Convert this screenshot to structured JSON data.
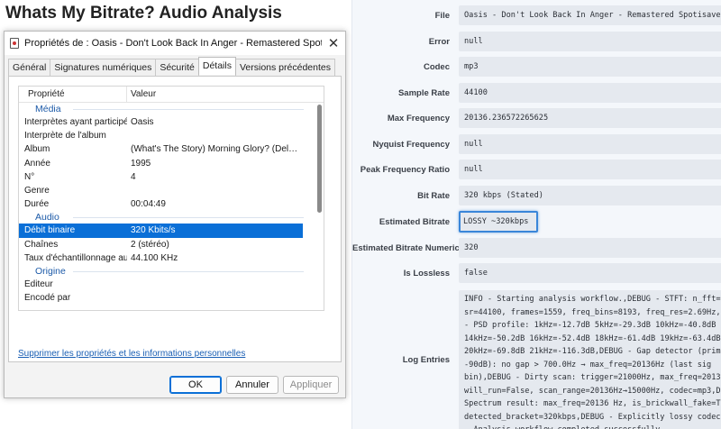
{
  "page_title": "Whats My Bitrate? Audio Analysis",
  "dialog": {
    "title": "Propriétés de : Oasis - Don't Look Back In Anger - Remastered Spotisaver.m...",
    "close_glyph": "✕",
    "tabs": [
      "Général",
      "Signatures numériques",
      "Sécurité",
      "Détails",
      "Versions précédentes"
    ],
    "active_tab": "Détails",
    "columns": {
      "property": "Propriété",
      "value": "Valeur"
    },
    "groups": [
      {
        "label": "Média",
        "rows": [
          {
            "prop": "Interprètes ayant participé",
            "val": "Oasis"
          },
          {
            "prop": "Interprète de l'album",
            "val": ""
          },
          {
            "prop": "Album",
            "val": "(What's The Story) Morning Glory? (Deluxe Re..."
          },
          {
            "prop": "Année",
            "val": "1995"
          },
          {
            "prop": "N°",
            "val": "4"
          },
          {
            "prop": "Genre",
            "val": ""
          },
          {
            "prop": "Durée",
            "val": "00:04:49"
          }
        ]
      },
      {
        "label": "Audio",
        "rows": [
          {
            "prop": "Débit binaire",
            "val": "320 Kbits/s",
            "selected": true
          },
          {
            "prop": "Chaînes",
            "val": "2 (stéréo)"
          },
          {
            "prop": "Taux d'échantillonnage audio",
            "val": "44.100 KHz"
          }
        ]
      },
      {
        "label": "Origine",
        "rows": [
          {
            "prop": "Éditeur",
            "val": ""
          },
          {
            "prop": "Encodé par",
            "val": ""
          }
        ]
      }
    ],
    "remove_link": "Supprimer les propriétés et les informations personnelles",
    "buttons": {
      "ok": "OK",
      "cancel": "Annuler",
      "apply": "Appliquer"
    }
  },
  "analysis": {
    "fields": [
      {
        "label": "File",
        "value": "Oasis - Don't Look Back In Anger - Remastered Spotisaver"
      },
      {
        "label": "Error",
        "value": "null"
      },
      {
        "label": "Codec",
        "value": "mp3"
      },
      {
        "label": "Sample Rate",
        "value": "44100"
      },
      {
        "label": "Max Frequency",
        "value": "20136.236572265625"
      },
      {
        "label": "Nyquist Frequency",
        "value": "null"
      },
      {
        "label": "Peak Frequency Ratio",
        "value": "null"
      },
      {
        "label": "Bit Rate",
        "value": "320 kbps (Stated)"
      },
      {
        "label": "Estimated Bitrate",
        "value": "LOSSY ~320kbps",
        "highlight": true
      },
      {
        "label": "Estimated Bitrate Numeric",
        "value": "320"
      },
      {
        "label": "Is Lossless",
        "value": "false"
      }
    ],
    "log_label": "Log Entries",
    "log_lines": [
      "INFO - Starting analysis workflow.,DEBUG - STFT: n_fft=",
      "sr=44100, frames=1559, freq_bins=8193, freq_res=2.69Hz,",
      "- PSD profile: 1kHz=-12.7dB 5kHz=-29.3dB 10kHz=-40.8dB",
      "14kHz=-50.2dB 16kHz=-52.4dB 18kHz=-61.4dB 19kHz=-63.4dB",
      "20kHz=-69.8dB 21kHz=-116.3dB,DEBUG - Gap detector (prim",
      "-90dB): no gap > 700.0Hz → max_freq=20136Hz (last sig",
      "bin),DEBUG - Dirty scan: trigger=21000Hz, max_freq=2013",
      "will_run=False, scan_range=20136Hz→15000Hz, codec=mp3,D",
      "Spectrum result: max_freq=20136 Hz, is_brickwall_fake=T",
      "detected_bracket=320kbps,DEBUG - Explicitly lossy codec",
      "- Analysis workflow completed successfully."
    ]
  }
}
